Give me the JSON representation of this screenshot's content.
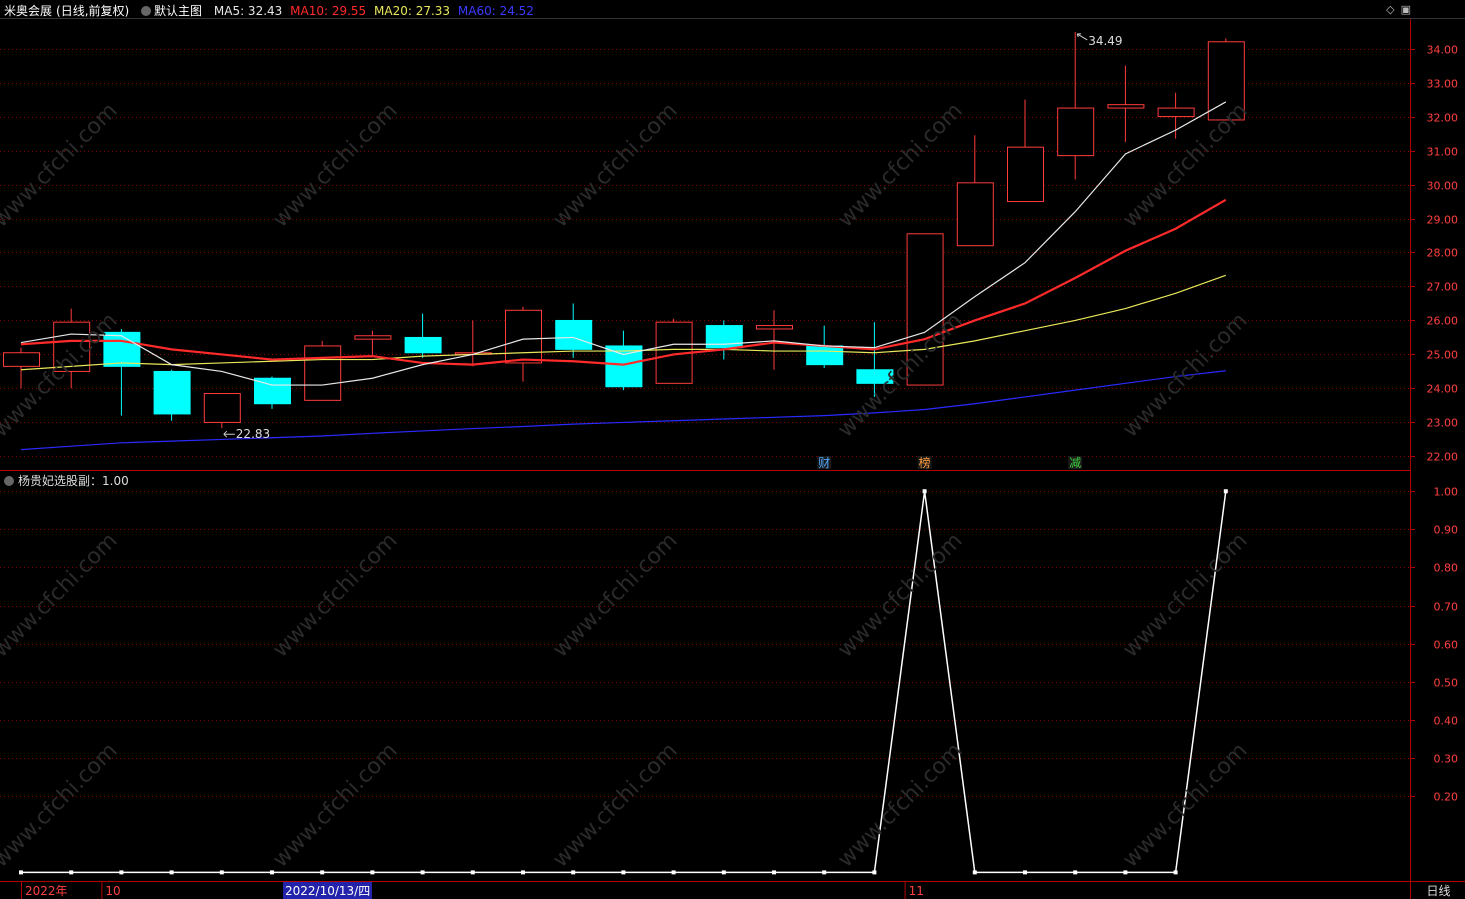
{
  "header": {
    "stock_name": "米奥会展",
    "period_info": "(日线,前复权)",
    "main_chart_label": "默认主图",
    "ma5": {
      "label": "MA5: 32.43",
      "color": "#e8e8e8"
    },
    "ma10": {
      "label": "MA10: 29.55",
      "color": "#ff2a2a"
    },
    "ma20": {
      "label": "MA20: 27.33",
      "color": "#e8e85a"
    },
    "ma60": {
      "label": "MA60: 24.52",
      "color": "#2a2aff"
    }
  },
  "sub_header": {
    "name": "杨贵妃选股副：1.00"
  },
  "period_label": "日线",
  "selected_date": "2022/10/13/四",
  "colors": {
    "up": "#ff3b3b",
    "down": "#00ffff",
    "grid": "#8b0000",
    "axis": "#b00000",
    "axis_text": "#ff4040"
  },
  "chart_data": [
    {
      "type": "candlestick",
      "y_ticks": [
        22.0,
        23.0,
        24.0,
        25.0,
        26.0,
        27.0,
        28.0,
        29.0,
        30.0,
        31.0,
        32.0,
        33.0,
        34.0
      ],
      "y_tick_labels": [
        "22.00",
        "23.00",
        "24.00",
        "25.00",
        "26.00",
        "27.00",
        "28.00",
        "29.00",
        "30.00",
        "31.00",
        "32.00",
        "33.00",
        "34.00"
      ],
      "ylim": [
        21.6,
        34.9
      ],
      "x_labels": [
        {
          "index": 0,
          "text": "2022年"
        },
        {
          "index": 2,
          "text": "10"
        },
        {
          "index": 18,
          "text": "11"
        }
      ],
      "candles": [
        {
          "o": 24.65,
          "h": 25.2,
          "l": 24.0,
          "c": 25.05
        },
        {
          "o": 24.5,
          "h": 26.35,
          "l": 24.0,
          "c": 25.95
        },
        {
          "o": 25.65,
          "h": 25.75,
          "l": 23.2,
          "c": 24.65
        },
        {
          "o": 24.5,
          "h": 24.55,
          "l": 23.05,
          "c": 23.25
        },
        {
          "o": 23.0,
          "h": 23.85,
          "l": 22.83,
          "c": 23.85
        },
        {
          "o": 24.3,
          "h": 24.35,
          "l": 23.4,
          "c": 23.55
        },
        {
          "o": 23.65,
          "h": 25.4,
          "l": 23.65,
          "c": 25.25
        },
        {
          "o": 25.45,
          "h": 25.7,
          "l": 24.95,
          "c": 25.55
        },
        {
          "o": 25.5,
          "h": 26.2,
          "l": 24.9,
          "c": 25.05
        },
        {
          "o": 25.05,
          "h": 26.0,
          "l": 24.65,
          "c": 25.05
        },
        {
          "o": 24.75,
          "h": 26.4,
          "l": 24.2,
          "c": 26.3
        },
        {
          "o": 26.0,
          "h": 26.5,
          "l": 24.9,
          "c": 25.15
        },
        {
          "o": 25.25,
          "h": 25.7,
          "l": 23.95,
          "c": 24.05
        },
        {
          "o": 24.15,
          "h": 26.05,
          "l": 24.15,
          "c": 25.95
        },
        {
          "o": 25.85,
          "h": 26.0,
          "l": 24.85,
          "c": 25.2
        },
        {
          "o": 25.75,
          "h": 26.3,
          "l": 24.55,
          "c": 25.85
        },
        {
          "o": 25.25,
          "h": 25.85,
          "l": 24.6,
          "c": 24.7
        },
        {
          "o": 24.55,
          "h": 25.95,
          "l": 23.75,
          "c": 24.15
        },
        {
          "o": 24.1,
          "h": 28.55,
          "l": 24.1,
          "c": 28.55
        },
        {
          "o": 28.2,
          "h": 31.45,
          "l": 28.2,
          "c": 30.05
        },
        {
          "o": 29.5,
          "h": 32.5,
          "l": 29.5,
          "c": 31.1
        },
        {
          "o": 30.85,
          "h": 34.49,
          "l": 30.15,
          "c": 32.25
        },
        {
          "o": 32.25,
          "h": 33.5,
          "l": 31.25,
          "c": 32.35
        },
        {
          "o": 32.0,
          "h": 32.7,
          "l": 31.35,
          "c": 32.25
        },
        {
          "o": 31.9,
          "h": 34.3,
          "l": 31.9,
          "c": 34.2
        }
      ],
      "ma5": [
        25.35,
        25.6,
        25.55,
        24.7,
        24.5,
        24.1,
        24.1,
        24.3,
        24.7,
        25.0,
        25.45,
        25.5,
        25.0,
        25.3,
        25.3,
        25.4,
        25.25,
        25.2,
        25.65,
        26.7,
        27.7,
        29.2,
        30.9,
        31.6,
        32.43
      ],
      "ma10": [
        25.3,
        25.4,
        25.4,
        25.15,
        25.0,
        24.85,
        24.9,
        24.95,
        24.75,
        24.7,
        24.85,
        24.8,
        24.7,
        25.0,
        25.15,
        25.35,
        25.25,
        25.15,
        25.45,
        26.0,
        26.5,
        27.25,
        28.05,
        28.7,
        29.55
      ],
      "ma20": [
        24.55,
        24.65,
        24.75,
        24.7,
        24.75,
        24.8,
        24.85,
        24.85,
        24.95,
        25.0,
        25.05,
        25.1,
        25.1,
        25.15,
        25.15,
        25.1,
        25.1,
        25.05,
        25.15,
        25.4,
        25.7,
        26.0,
        26.35,
        26.8,
        27.33
      ],
      "ma60": [
        22.2,
        22.3,
        22.4,
        22.45,
        22.5,
        22.55,
        22.6,
        22.68,
        22.75,
        22.82,
        22.88,
        22.95,
        23.0,
        23.05,
        23.1,
        23.15,
        23.2,
        23.28,
        23.38,
        23.55,
        23.75,
        23.95,
        24.15,
        24.35,
        24.52
      ],
      "annotations": [
        {
          "index": 4,
          "label": "22.83"
        },
        {
          "index": 21,
          "label": "34.49"
        }
      ],
      "event_markers": [
        {
          "index": 16,
          "text": "财",
          "color": "#4ea6ff"
        },
        {
          "index": 18,
          "text": "榜",
          "color": "#ff9a3a"
        },
        {
          "index": 21,
          "text": "减",
          "color": "#3ccf3c"
        }
      ]
    },
    {
      "type": "line",
      "name": "杨贵妃选股副",
      "y_ticks": [
        0.2,
        0.3,
        0.4,
        0.5,
        0.6,
        0.7,
        0.8,
        0.9,
        1.0
      ],
      "y_tick_labels": [
        "0.20",
        "0.30",
        "0.40",
        "0.50",
        "0.60",
        "0.70",
        "0.80",
        "0.90",
        "1.00"
      ],
      "ylim": [
        -0.02,
        1.04
      ],
      "values": [
        0,
        0,
        0,
        0,
        0,
        0,
        0,
        0,
        0,
        0,
        0,
        0,
        0,
        0,
        0,
        0,
        0,
        0,
        1,
        0,
        0,
        0,
        0,
        0,
        1
      ]
    }
  ]
}
